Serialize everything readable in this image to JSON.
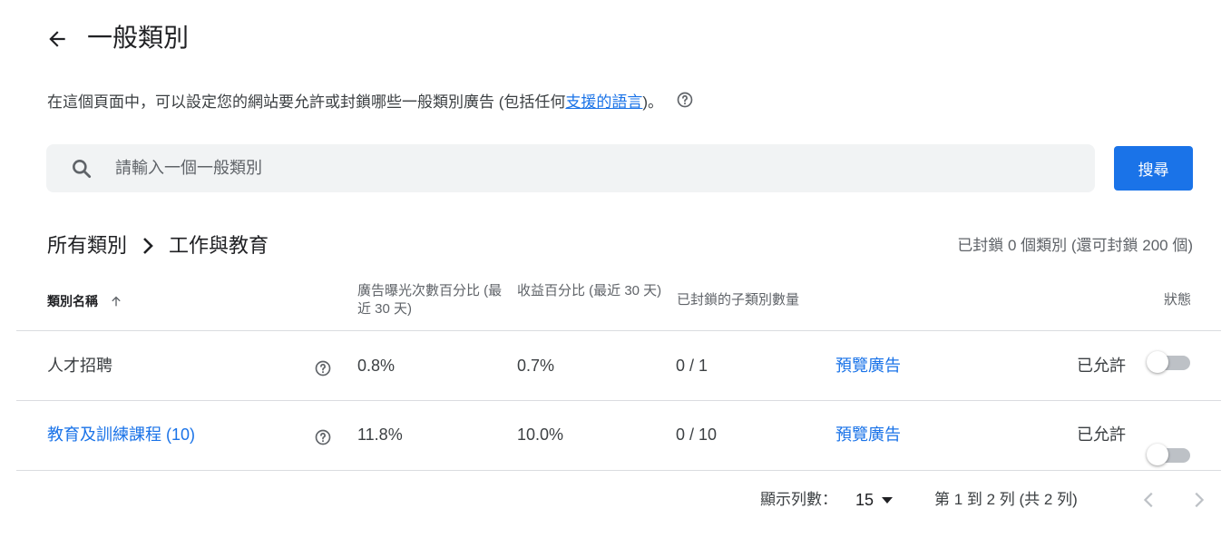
{
  "header": {
    "title": "一般類別"
  },
  "description": {
    "text_before": "在這個頁面中，可以設定您的網站要允許或封鎖哪些一般類別廣告 (包括任何",
    "link": "支援的語言",
    "text_after": ")。"
  },
  "search": {
    "placeholder": "請輸入一個一般類別",
    "value": "",
    "button_label": "搜尋"
  },
  "breadcrumb": {
    "root": "所有類別",
    "current": "工作與教育"
  },
  "blocked_summary": "已封鎖 0 個類別 (還可封鎖 200 個)",
  "table": {
    "columns": {
      "name": "類別名稱",
      "impressions": "廣告曝光次數百分比 (最近 30 天)",
      "revenue": "收益百分比 (最近 30 天)",
      "blocked_sub": "已封鎖的子類別數量",
      "status": "狀態"
    },
    "rows": [
      {
        "name": "人才招聘",
        "name_is_link": false,
        "impressions": "0.8%",
        "revenue": "0.7%",
        "blocked_sub": "0 / 1",
        "preview": "預覽廣告",
        "status": "已允許",
        "enabled": false
      },
      {
        "name": "教育及訓練課程 (10)",
        "name_is_link": true,
        "impressions": "11.8%",
        "revenue": "10.0%",
        "blocked_sub": "0 / 10",
        "preview": "預覽廣告",
        "status": "已允許",
        "enabled": false
      }
    ]
  },
  "pagination": {
    "rows_label": "顯示列數：",
    "rows_value": "15",
    "range": "第 1 到 2 列 (共 2 列)"
  },
  "colors": {
    "accent": "#1a73e8",
    "text": "#202124",
    "muted": "#5f6368",
    "divider": "#dadce0",
    "search_bg": "#f1f3f4"
  }
}
